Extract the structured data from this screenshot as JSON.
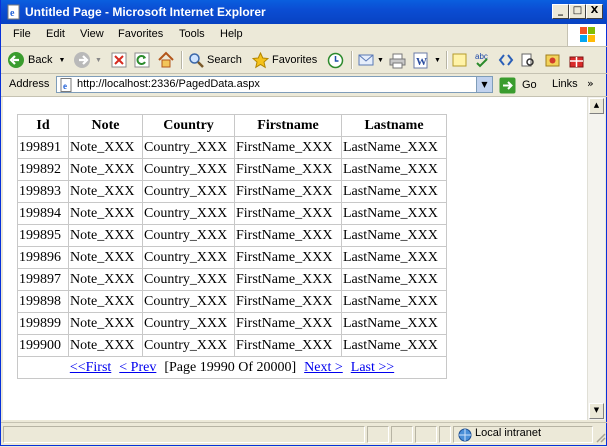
{
  "window": {
    "title": "Untitled Page - Microsoft Internet Explorer",
    "minimize": "_",
    "maximize": "□",
    "close": "X"
  },
  "menu": [
    "File",
    "Edit",
    "View",
    "Favorites",
    "Tools",
    "Help"
  ],
  "toolbar": {
    "back_label": "Back",
    "search_label": "Search",
    "favorites_label": "Favorites"
  },
  "address": {
    "label": "Address",
    "url": "http://localhost:2336/PagedData.aspx",
    "go_label": "Go",
    "links_label": "Links"
  },
  "grid": {
    "headers": [
      "Id",
      "Note",
      "Country",
      "Firstname",
      "Lastname"
    ],
    "rows": [
      [
        "199891",
        "Note_XXX",
        "Country_XXX",
        "FirstName_XXX",
        "LastName_XXX"
      ],
      [
        "199892",
        "Note_XXX",
        "Country_XXX",
        "FirstName_XXX",
        "LastName_XXX"
      ],
      [
        "199893",
        "Note_XXX",
        "Country_XXX",
        "FirstName_XXX",
        "LastName_XXX"
      ],
      [
        "199894",
        "Note_XXX",
        "Country_XXX",
        "FirstName_XXX",
        "LastName_XXX"
      ],
      [
        "199895",
        "Note_XXX",
        "Country_XXX",
        "FirstName_XXX",
        "LastName_XXX"
      ],
      [
        "199896",
        "Note_XXX",
        "Country_XXX",
        "FirstName_XXX",
        "LastName_XXX"
      ],
      [
        "199897",
        "Note_XXX",
        "Country_XXX",
        "FirstName_XXX",
        "LastName_XXX"
      ],
      [
        "199898",
        "Note_XXX",
        "Country_XXX",
        "FirstName_XXX",
        "LastName_XXX"
      ],
      [
        "199899",
        "Note_XXX",
        "Country_XXX",
        "FirstName_XXX",
        "LastName_XXX"
      ],
      [
        "199900",
        "Note_XXX",
        "Country_XXX",
        "FirstName_XXX",
        "LastName_XXX"
      ]
    ],
    "pager": {
      "first": "<<First",
      "prev": "< Prev",
      "info": "[Page 19990 Of 20000]",
      "next": "Next >",
      "last": "Last >>"
    }
  },
  "status": {
    "zone": "Local intranet"
  },
  "colors": {
    "titlebar": "#0b4dd3",
    "chrome": "#ece9d8",
    "link": "#0000ee"
  },
  "icons": [
    "ie-page-icon",
    "back-arrow-icon",
    "forward-arrow-icon",
    "stop-icon",
    "refresh-icon",
    "home-icon",
    "search-icon",
    "favorites-star-icon",
    "history-icon",
    "mail-icon",
    "print-icon",
    "edit-icon",
    "discuss-icon",
    "spellcheck-icon",
    "go-arrow-icon",
    "windows-logo-icon",
    "local-intranet-icon"
  ]
}
